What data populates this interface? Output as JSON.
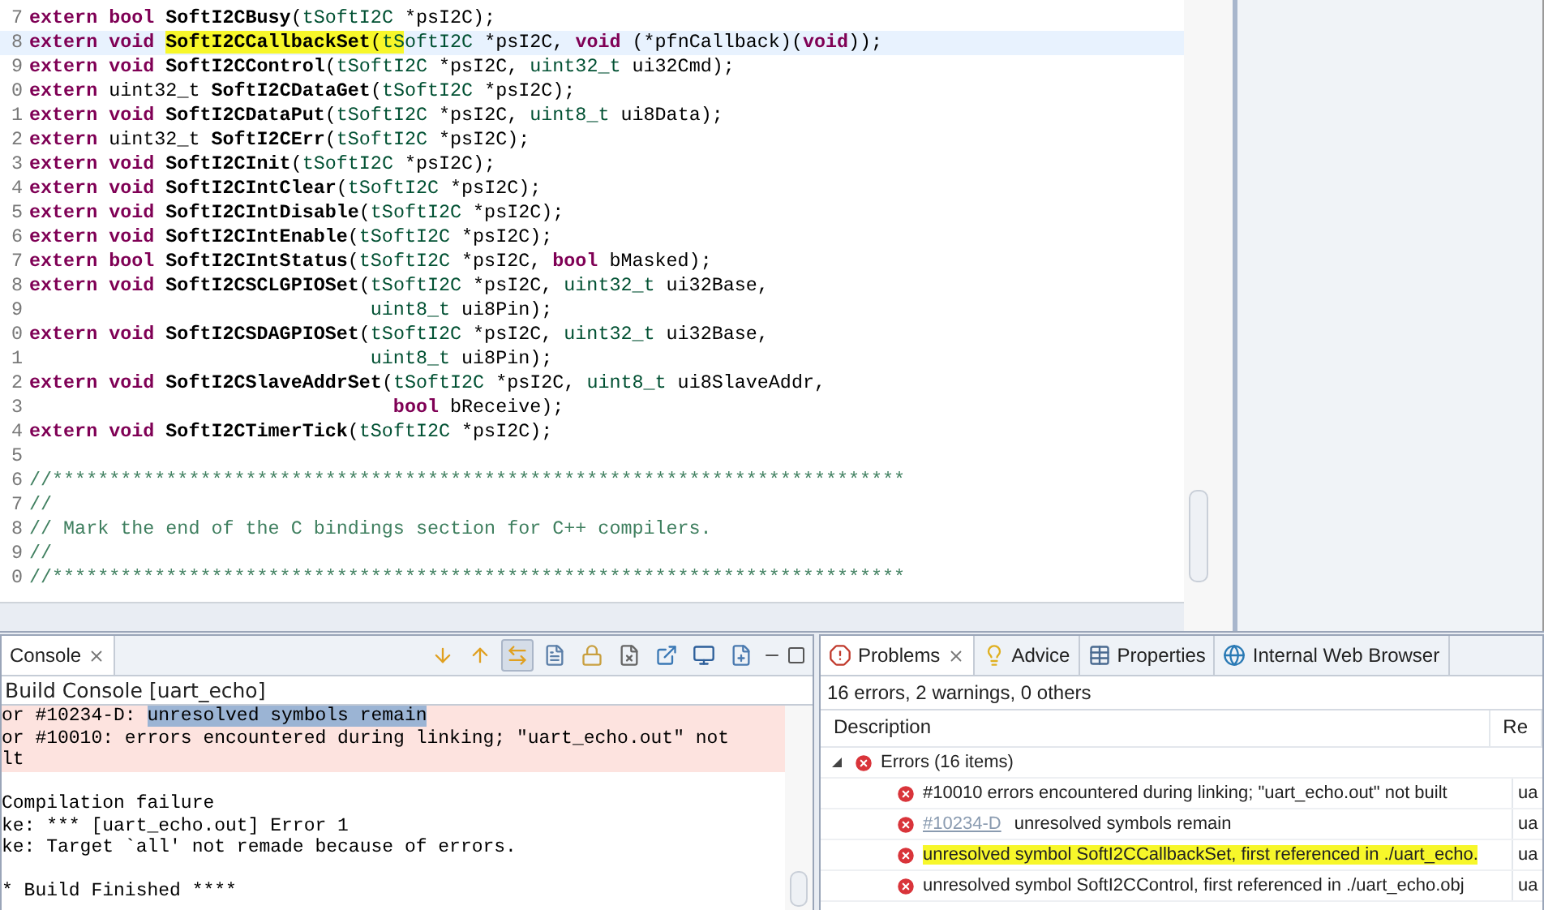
{
  "editor": {
    "lines": [
      {
        "number": "7",
        "current": false,
        "tokens": [
          {
            "kind": "keyword",
            "text": "extern bool "
          },
          {
            "kind": "function",
            "text": "SoftI2CBusy"
          },
          {
            "kind": "plain",
            "text": "("
          },
          {
            "kind": "type",
            "text": "tSoftI2C"
          },
          {
            "kind": "plain",
            "text": " *psI2C);"
          }
        ]
      },
      {
        "number": "8",
        "current": true,
        "tokens": [
          {
            "kind": "keyword",
            "text": "extern void ",
            "highlighted": false
          },
          {
            "kind": "function",
            "text": "SoftI2CCallbackSet",
            "highlighted": true
          },
          {
            "kind": "plain",
            "text": "(",
            "highlighted": true
          },
          {
            "kind": "type",
            "text": "tS",
            "highlighted": true
          },
          {
            "kind": "type",
            "text": "oftI2C",
            "highlighted": false
          },
          {
            "kind": "plain",
            "text": " *psI2C, ",
            "highlighted": false
          },
          {
            "kind": "keyword",
            "text": "void",
            "highlighted": false
          },
          {
            "kind": "plain",
            "text": " (*pfnCallback)(",
            "highlighted": false
          },
          {
            "kind": "keyword",
            "text": "void",
            "highlighted": false
          },
          {
            "kind": "plain",
            "text": "));",
            "highlighted": false
          }
        ]
      },
      {
        "number": "9",
        "current": false,
        "tokens": [
          {
            "kind": "keyword",
            "text": "extern void "
          },
          {
            "kind": "function",
            "text": "SoftI2CControl"
          },
          {
            "kind": "plain",
            "text": "("
          },
          {
            "kind": "type",
            "text": "tSoftI2C"
          },
          {
            "kind": "plain",
            "text": " *psI2C, "
          },
          {
            "kind": "type",
            "text": "uint32_t"
          },
          {
            "kind": "plain",
            "text": " ui32Cmd);"
          }
        ]
      },
      {
        "number": "0",
        "current": false,
        "tokens": [
          {
            "kind": "keyword",
            "text": "extern "
          },
          {
            "kind": "plain",
            "text": "uint32_t "
          },
          {
            "kind": "function",
            "text": "SoftI2CDataGet"
          },
          {
            "kind": "plain",
            "text": "("
          },
          {
            "kind": "type",
            "text": "tSoftI2C"
          },
          {
            "kind": "plain",
            "text": " *psI2C);"
          }
        ]
      },
      {
        "number": "1",
        "current": false,
        "tokens": [
          {
            "kind": "keyword",
            "text": "extern void "
          },
          {
            "kind": "function",
            "text": "SoftI2CDataPut"
          },
          {
            "kind": "plain",
            "text": "("
          },
          {
            "kind": "type",
            "text": "tSoftI2C"
          },
          {
            "kind": "plain",
            "text": " *psI2C, "
          },
          {
            "kind": "type",
            "text": "uint8_t"
          },
          {
            "kind": "plain",
            "text": " ui8Data);"
          }
        ]
      },
      {
        "number": "2",
        "current": false,
        "tokens": [
          {
            "kind": "keyword",
            "text": "extern "
          },
          {
            "kind": "plain",
            "text": "uint32_t "
          },
          {
            "kind": "function",
            "text": "SoftI2CErr"
          },
          {
            "kind": "plain",
            "text": "("
          },
          {
            "kind": "type",
            "text": "tSoftI2C"
          },
          {
            "kind": "plain",
            "text": " *psI2C);"
          }
        ]
      },
      {
        "number": "3",
        "current": false,
        "tokens": [
          {
            "kind": "keyword",
            "text": "extern void "
          },
          {
            "kind": "function",
            "text": "SoftI2CInit"
          },
          {
            "kind": "plain",
            "text": "("
          },
          {
            "kind": "type",
            "text": "tSoftI2C"
          },
          {
            "kind": "plain",
            "text": " *psI2C);"
          }
        ]
      },
      {
        "number": "4",
        "current": false,
        "tokens": [
          {
            "kind": "keyword",
            "text": "extern void "
          },
          {
            "kind": "function",
            "text": "SoftI2CIntClear"
          },
          {
            "kind": "plain",
            "text": "("
          },
          {
            "kind": "type",
            "text": "tSoftI2C"
          },
          {
            "kind": "plain",
            "text": " *psI2C);"
          }
        ]
      },
      {
        "number": "5",
        "current": false,
        "tokens": [
          {
            "kind": "keyword",
            "text": "extern void "
          },
          {
            "kind": "function",
            "text": "SoftI2CIntDisable"
          },
          {
            "kind": "plain",
            "text": "("
          },
          {
            "kind": "type",
            "text": "tSoftI2C"
          },
          {
            "kind": "plain",
            "text": " *psI2C);"
          }
        ]
      },
      {
        "number": "6",
        "current": false,
        "tokens": [
          {
            "kind": "keyword",
            "text": "extern void "
          },
          {
            "kind": "function",
            "text": "SoftI2CIntEnable"
          },
          {
            "kind": "plain",
            "text": "("
          },
          {
            "kind": "type",
            "text": "tSoftI2C"
          },
          {
            "kind": "plain",
            "text": " *psI2C);"
          }
        ]
      },
      {
        "number": "7",
        "current": false,
        "tokens": [
          {
            "kind": "keyword",
            "text": "extern bool "
          },
          {
            "kind": "function",
            "text": "SoftI2CIntStatus"
          },
          {
            "kind": "plain",
            "text": "("
          },
          {
            "kind": "type",
            "text": "tSoftI2C"
          },
          {
            "kind": "plain",
            "text": " *psI2C, "
          },
          {
            "kind": "keyword",
            "text": "bool"
          },
          {
            "kind": "plain",
            "text": " bMasked);"
          }
        ]
      },
      {
        "number": "8",
        "current": false,
        "tokens": [
          {
            "kind": "keyword",
            "text": "extern void "
          },
          {
            "kind": "function",
            "text": "SoftI2CSCLGPIOSet"
          },
          {
            "kind": "plain",
            "text": "("
          },
          {
            "kind": "type",
            "text": "tSoftI2C"
          },
          {
            "kind": "plain",
            "text": " *psI2C, "
          },
          {
            "kind": "type",
            "text": "uint32_t"
          },
          {
            "kind": "plain",
            "text": " ui32Base,"
          }
        ]
      },
      {
        "number": "9",
        "current": false,
        "tokens": [
          {
            "kind": "type",
            "text": "                              uint8_t"
          },
          {
            "kind": "plain",
            "text": " ui8Pin);"
          }
        ]
      },
      {
        "number": "0",
        "current": false,
        "tokens": [
          {
            "kind": "keyword",
            "text": "extern void "
          },
          {
            "kind": "function",
            "text": "SoftI2CSDAGPIOSet"
          },
          {
            "kind": "plain",
            "text": "("
          },
          {
            "kind": "type",
            "text": "tSoftI2C"
          },
          {
            "kind": "plain",
            "text": " *psI2C, "
          },
          {
            "kind": "type",
            "text": "uint32_t"
          },
          {
            "kind": "plain",
            "text": " ui32Base,"
          }
        ]
      },
      {
        "number": "1",
        "current": false,
        "tokens": [
          {
            "kind": "type",
            "text": "                              uint8_t"
          },
          {
            "kind": "plain",
            "text": " ui8Pin);"
          }
        ]
      },
      {
        "number": "2",
        "current": false,
        "tokens": [
          {
            "kind": "keyword",
            "text": "extern void "
          },
          {
            "kind": "function",
            "text": "SoftI2CSlaveAddrSet"
          },
          {
            "kind": "plain",
            "text": "("
          },
          {
            "kind": "type",
            "text": "tSoftI2C"
          },
          {
            "kind": "plain",
            "text": " *psI2C, "
          },
          {
            "kind": "type",
            "text": "uint8_t"
          },
          {
            "kind": "plain",
            "text": " ui8SlaveAddr,"
          }
        ]
      },
      {
        "number": "3",
        "current": false,
        "tokens": [
          {
            "kind": "keyword",
            "text": "                                bool"
          },
          {
            "kind": "plain",
            "text": " bReceive);"
          }
        ]
      },
      {
        "number": "4",
        "current": false,
        "tokens": [
          {
            "kind": "keyword",
            "text": "extern void "
          },
          {
            "kind": "function",
            "text": "SoftI2CTimerTick"
          },
          {
            "kind": "plain",
            "text": "("
          },
          {
            "kind": "type",
            "text": "tSoftI2C"
          },
          {
            "kind": "plain",
            "text": " *psI2C);"
          }
        ]
      },
      {
        "number": "5",
        "current": false
      },
      {
        "number": "6",
        "current": false,
        "tokens": [
          {
            "kind": "comment",
            "text": "//***************************************************************************"
          }
        ]
      },
      {
        "number": "7",
        "current": false,
        "tokens": [
          {
            "kind": "comment",
            "text": "//"
          }
        ]
      },
      {
        "number": "8",
        "current": false,
        "tokens": [
          {
            "kind": "comment",
            "text": "// Mark the end of the C bindings section for C++ compilers."
          }
        ]
      },
      {
        "number": "9",
        "current": false,
        "tokens": [
          {
            "kind": "comment",
            "text": "//"
          }
        ]
      },
      {
        "number": "0",
        "current": false,
        "tokens": [
          {
            "kind": "comment",
            "text": "//***************************************************************************"
          }
        ]
      }
    ]
  },
  "console": {
    "tab": "Console",
    "toolbar": [
      {
        "selected": false
      },
      {
        "selected": false
      },
      {
        "selected": true
      },
      {
        "selected": false
      },
      {
        "selected": false
      },
      {
        "selected": false
      },
      {
        "selected": false
      },
      {
        "selected": false
      },
      {
        "selected": false
      }
    ],
    "subtitle": "Build Console [uart_echo]",
    "lines": [
      {
        "kind": "error",
        "parts": [
          {
            "text": "or #10234-D: ",
            "selected": false
          },
          {
            "text": "unresolved symbols remain",
            "selected": true
          }
        ]
      },
      {
        "kind": "error",
        "parts": [
          {
            "text": "or #10010: errors encountered during linking; \"uart_echo.out\" not",
            "selected": false
          }
        ]
      },
      {
        "kind": "error",
        "parts": [
          {
            "text": "lt",
            "selected": false
          }
        ]
      },
      {
        "kind": "blank"
      },
      {
        "kind": "plain",
        "parts": [
          {
            "text": "Compilation failure",
            "selected": false
          }
        ]
      },
      {
        "kind": "plain",
        "parts": [
          {
            "text": "ke: *** [uart_echo.out] Error 1",
            "selected": false
          }
        ]
      },
      {
        "kind": "plain",
        "parts": [
          {
            "text": "ke: Target `all' not remade because of errors.",
            "selected": false
          }
        ]
      },
      {
        "kind": "blank"
      },
      {
        "kind": "plain",
        "parts": [
          {
            "text": "* Build Finished ****",
            "selected": false
          }
        ]
      }
    ]
  },
  "problems": {
    "tabs": [
      {
        "label": "Problems",
        "selected": true
      },
      {
        "label": "Advice",
        "selected": false
      },
      {
        "label": "Properties",
        "selected": false
      },
      {
        "label": "Internal Web Browser",
        "selected": false
      }
    ],
    "summary": "16 errors, 2 warnings, 0 others",
    "columns": [
      "Description",
      "Re"
    ],
    "groups": [
      {
        "label": "Errors (16 items)",
        "expanded": true,
        "children": [
          {
            "text": "#10010 errors encountered during linking; \"uart_echo.out\" not built",
            "resource": "ua",
            "highlighted": false
          },
          {
            "code": "#10234-D",
            "text": "unresolved symbols remain",
            "resource": "ua",
            "highlighted": false
          },
          {
            "text": "unresolved symbol SoftI2CCallbackSet, first referenced in ./uart_echo.",
            "resource": "ua",
            "highlighted": true
          },
          {
            "text": "unresolved symbol SoftI2CControl, first referenced in ./uart_echo.obj",
            "resource": "ua",
            "highlighted": false
          }
        ]
      }
    ]
  }
}
